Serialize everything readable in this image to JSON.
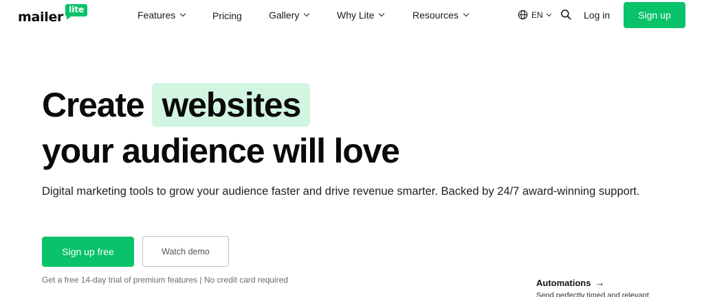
{
  "brand": {
    "name": "mailer",
    "badge": "lite",
    "accent_color": "#09c269",
    "highlight_color": "#d2f5e2"
  },
  "nav": {
    "items": [
      {
        "label": "Features",
        "has_dropdown": true
      },
      {
        "label": "Pricing",
        "has_dropdown": false
      },
      {
        "label": "Gallery",
        "has_dropdown": true
      },
      {
        "label": "Why Lite",
        "has_dropdown": true
      },
      {
        "label": "Resources",
        "has_dropdown": true
      }
    ],
    "language": "EN",
    "language_icon": "globe-icon",
    "search_icon": "search-icon",
    "login": "Log in",
    "signup": "Sign up"
  },
  "hero": {
    "title_word1": "Create",
    "title_highlight": "websites",
    "title_line2": "your audience will love",
    "subtitle": "Digital marketing tools to grow your audience faster and drive revenue smarter. Backed by 24/7 award-winning support.",
    "cta_primary": "Sign up free",
    "cta_secondary": "Watch demo",
    "trial_note": "Get a free 14-day trial of premium features | No credit card required"
  },
  "automations": {
    "label": "Automations",
    "arrow": "→",
    "subtext": "Send perfectly timed and relevant"
  }
}
